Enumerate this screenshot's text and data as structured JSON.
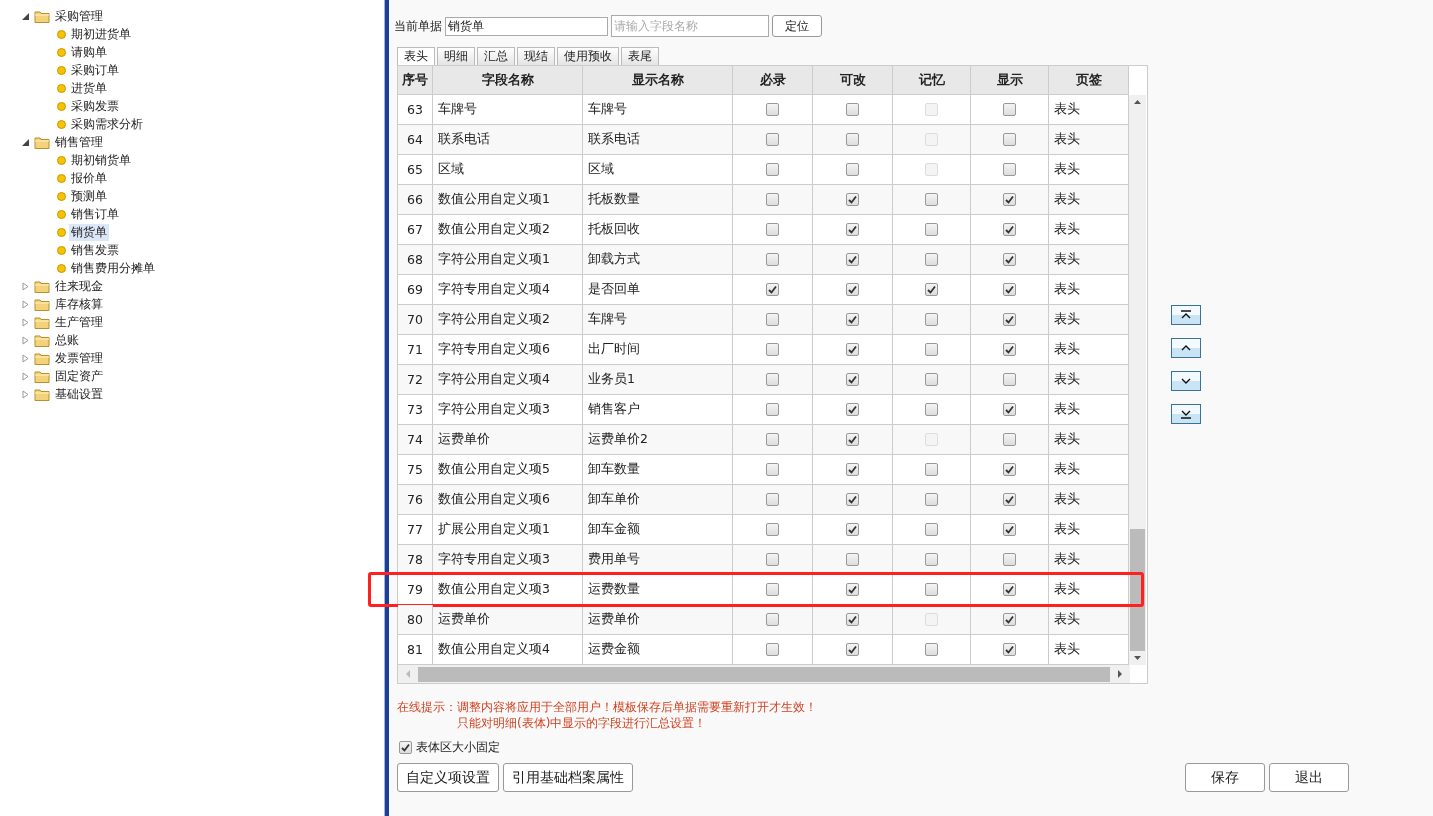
{
  "tree": [
    {
      "label": "采购管理",
      "expanded": true,
      "children": [
        {
          "label": "期初进货单",
          "selected": false
        },
        {
          "label": "请购单",
          "selected": false
        },
        {
          "label": "采购订单",
          "selected": false
        },
        {
          "label": "进货单",
          "selected": false
        },
        {
          "label": "采购发票",
          "selected": false
        },
        {
          "label": "采购需求分析",
          "selected": false
        }
      ]
    },
    {
      "label": "销售管理",
      "expanded": true,
      "children": [
        {
          "label": "期初销货单",
          "selected": false
        },
        {
          "label": "报价单",
          "selected": false
        },
        {
          "label": "预测单",
          "selected": false
        },
        {
          "label": "销售订单",
          "selected": false
        },
        {
          "label": "销货单",
          "selected": true
        },
        {
          "label": "销售发票",
          "selected": false
        },
        {
          "label": "销售费用分摊单",
          "selected": false
        }
      ]
    },
    {
      "label": "往来现金",
      "expanded": false
    },
    {
      "label": "库存核算",
      "expanded": false
    },
    {
      "label": "生产管理",
      "expanded": false
    },
    {
      "label": "总账",
      "expanded": false
    },
    {
      "label": "发票管理",
      "expanded": false
    },
    {
      "label": "固定资产",
      "expanded": false
    },
    {
      "label": "基础设置",
      "expanded": false
    }
  ],
  "toolbar": {
    "label": "当前单据",
    "document": "销货单",
    "search_placeholder": "请输入字段名称",
    "locate_button": "定位"
  },
  "tabs": [
    {
      "label": "表头",
      "selected": true
    },
    {
      "label": "明细",
      "selected": false
    },
    {
      "label": "汇总",
      "selected": false
    },
    {
      "label": "现结",
      "selected": false
    },
    {
      "label": "使用预收",
      "selected": false
    },
    {
      "label": "表尾",
      "selected": false
    }
  ],
  "table": {
    "columns": [
      "序号",
      "字段名称",
      "显示名称",
      "必录",
      "可改",
      "记忆",
      "显示",
      "页签"
    ],
    "rows": [
      {
        "no": "63",
        "field": "车牌号",
        "display": "车牌号",
        "flags": [
          {
            "checked": false,
            "disabled": false
          },
          {
            "checked": false,
            "disabled": false
          },
          {
            "checked": false,
            "disabled": true
          },
          {
            "checked": false,
            "disabled": false
          }
        ],
        "tab": "表头",
        "highlighted": false
      },
      {
        "no": "64",
        "field": "联系电话",
        "display": "联系电话",
        "flags": [
          {
            "checked": false,
            "disabled": false
          },
          {
            "checked": false,
            "disabled": false
          },
          {
            "checked": false,
            "disabled": true
          },
          {
            "checked": false,
            "disabled": false
          }
        ],
        "tab": "表头",
        "highlighted": false
      },
      {
        "no": "65",
        "field": "区域",
        "display": "区域",
        "flags": [
          {
            "checked": false,
            "disabled": false
          },
          {
            "checked": false,
            "disabled": false
          },
          {
            "checked": false,
            "disabled": true
          },
          {
            "checked": false,
            "disabled": false
          }
        ],
        "tab": "表头",
        "highlighted": false
      },
      {
        "no": "66",
        "field": "数值公用自定义项1",
        "display": "托板数量",
        "flags": [
          {
            "checked": false,
            "disabled": false
          },
          {
            "checked": true,
            "disabled": false
          },
          {
            "checked": false,
            "disabled": false
          },
          {
            "checked": true,
            "disabled": false
          }
        ],
        "tab": "表头",
        "highlighted": false
      },
      {
        "no": "67",
        "field": "数值公用自定义项2",
        "display": "托板回收",
        "flags": [
          {
            "checked": false,
            "disabled": false
          },
          {
            "checked": true,
            "disabled": false
          },
          {
            "checked": false,
            "disabled": false
          },
          {
            "checked": true,
            "disabled": false
          }
        ],
        "tab": "表头",
        "highlighted": false
      },
      {
        "no": "68",
        "field": "字符公用自定义项1",
        "display": "卸载方式",
        "flags": [
          {
            "checked": false,
            "disabled": false
          },
          {
            "checked": true,
            "disabled": false
          },
          {
            "checked": false,
            "disabled": false
          },
          {
            "checked": true,
            "disabled": false
          }
        ],
        "tab": "表头",
        "highlighted": false
      },
      {
        "no": "69",
        "field": "字符专用自定义项4",
        "display": "是否回单",
        "flags": [
          {
            "checked": true,
            "disabled": false
          },
          {
            "checked": true,
            "disabled": false
          },
          {
            "checked": true,
            "disabled": false
          },
          {
            "checked": true,
            "disabled": false
          }
        ],
        "tab": "表头",
        "highlighted": false
      },
      {
        "no": "70",
        "field": "字符公用自定义项2",
        "display": "车牌号",
        "flags": [
          {
            "checked": false,
            "disabled": false
          },
          {
            "checked": true,
            "disabled": false
          },
          {
            "checked": false,
            "disabled": false
          },
          {
            "checked": true,
            "disabled": false
          }
        ],
        "tab": "表头",
        "highlighted": false
      },
      {
        "no": "71",
        "field": "字符专用自定义项6",
        "display": "出厂时间",
        "flags": [
          {
            "checked": false,
            "disabled": false
          },
          {
            "checked": true,
            "disabled": false
          },
          {
            "checked": false,
            "disabled": false
          },
          {
            "checked": true,
            "disabled": false
          }
        ],
        "tab": "表头",
        "highlighted": false
      },
      {
        "no": "72",
        "field": "字符公用自定义项4",
        "display": "业务员1",
        "flags": [
          {
            "checked": false,
            "disabled": false
          },
          {
            "checked": true,
            "disabled": false
          },
          {
            "checked": false,
            "disabled": false
          },
          {
            "checked": false,
            "disabled": false
          }
        ],
        "tab": "表头",
        "highlighted": false
      },
      {
        "no": "73",
        "field": "字符公用自定义项3",
        "display": "销售客户",
        "flags": [
          {
            "checked": false,
            "disabled": false
          },
          {
            "checked": true,
            "disabled": false
          },
          {
            "checked": false,
            "disabled": false
          },
          {
            "checked": true,
            "disabled": false
          }
        ],
        "tab": "表头",
        "highlighted": false
      },
      {
        "no": "74",
        "field": "运费单价",
        "display": "运费单价2",
        "flags": [
          {
            "checked": false,
            "disabled": false
          },
          {
            "checked": true,
            "disabled": false
          },
          {
            "checked": false,
            "disabled": true
          },
          {
            "checked": false,
            "disabled": false
          }
        ],
        "tab": "表头",
        "highlighted": false
      },
      {
        "no": "75",
        "field": "数值公用自定义项5",
        "display": "卸车数量",
        "flags": [
          {
            "checked": false,
            "disabled": false
          },
          {
            "checked": true,
            "disabled": false
          },
          {
            "checked": false,
            "disabled": false
          },
          {
            "checked": true,
            "disabled": false
          }
        ],
        "tab": "表头",
        "highlighted": false
      },
      {
        "no": "76",
        "field": "数值公用自定义项6",
        "display": "卸车单价",
        "flags": [
          {
            "checked": false,
            "disabled": false
          },
          {
            "checked": true,
            "disabled": false
          },
          {
            "checked": false,
            "disabled": false
          },
          {
            "checked": true,
            "disabled": false
          }
        ],
        "tab": "表头",
        "highlighted": false
      },
      {
        "no": "77",
        "field": "扩展公用自定义项1",
        "display": "卸车金额",
        "flags": [
          {
            "checked": false,
            "disabled": false
          },
          {
            "checked": true,
            "disabled": false
          },
          {
            "checked": false,
            "disabled": false
          },
          {
            "checked": true,
            "disabled": false
          }
        ],
        "tab": "表头",
        "highlighted": false
      },
      {
        "no": "78",
        "field": "字符专用自定义项3",
        "display": "费用单号",
        "flags": [
          {
            "checked": false,
            "disabled": false
          },
          {
            "checked": false,
            "disabled": false
          },
          {
            "checked": false,
            "disabled": false
          },
          {
            "checked": false,
            "disabled": false
          }
        ],
        "tab": "表头",
        "highlighted": false
      },
      {
        "no": "79",
        "field": "数值公用自定义项3",
        "display": "运费数量",
        "flags": [
          {
            "checked": false,
            "disabled": false
          },
          {
            "checked": true,
            "disabled": false
          },
          {
            "checked": false,
            "disabled": false
          },
          {
            "checked": true,
            "disabled": false
          }
        ],
        "tab": "表头",
        "highlighted": true
      },
      {
        "no": "80",
        "field": "运费单价",
        "display": "运费单价",
        "flags": [
          {
            "checked": false,
            "disabled": false
          },
          {
            "checked": true,
            "disabled": false
          },
          {
            "checked": false,
            "disabled": true
          },
          {
            "checked": true,
            "disabled": false
          }
        ],
        "tab": "表头",
        "highlighted": false
      },
      {
        "no": "81",
        "field": "数值公用自定义项4",
        "display": "运费金额",
        "flags": [
          {
            "checked": false,
            "disabled": false
          },
          {
            "checked": true,
            "disabled": false
          },
          {
            "checked": false,
            "disabled": false
          },
          {
            "checked": true,
            "disabled": false
          }
        ],
        "tab": "表头",
        "highlighted": false
      }
    ]
  },
  "move_buttons": [
    {
      "kind": "top"
    },
    {
      "kind": "up"
    },
    {
      "kind": "down"
    },
    {
      "kind": "bottom"
    }
  ],
  "hint": {
    "label": "在线提示：",
    "lines": [
      "调整内容将应用于全部用户！模板保存后单据需要重新打开才生效！",
      "只能对明细(表体)中显示的字段进行汇总设置！"
    ]
  },
  "fixed_size": {
    "label": "表体区大小固定",
    "checked": true
  },
  "left_buttons": [
    "自定义项设置",
    "引用基础档案属性"
  ],
  "right_buttons": [
    "保存",
    "退出"
  ]
}
